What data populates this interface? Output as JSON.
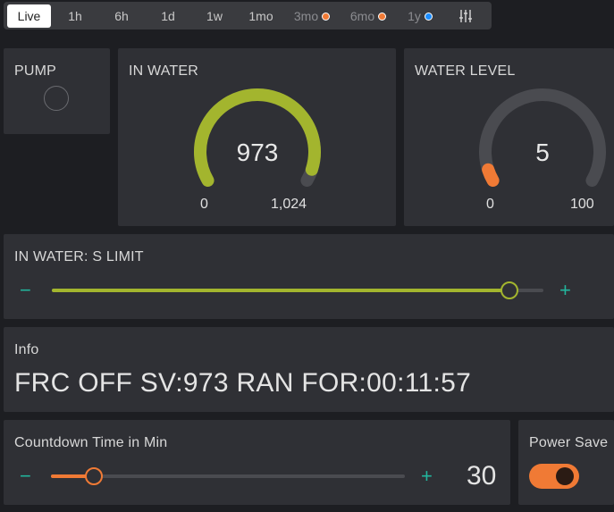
{
  "time_tabs": [
    {
      "label": "Live",
      "active": true
    },
    {
      "label": "1h"
    },
    {
      "label": "6h"
    },
    {
      "label": "1d"
    },
    {
      "label": "1w"
    },
    {
      "label": "1mo"
    },
    {
      "label": "3mo",
      "dot_color": "#f07a35",
      "dim": true
    },
    {
      "label": "6mo",
      "dot_color": "#f07a35",
      "dim": true
    },
    {
      "label": "1y",
      "dot_color": "#1a8cff",
      "dim": true
    }
  ],
  "settings_icon": "sliders-icon",
  "pump": {
    "title": "PUMP",
    "led_state": "off"
  },
  "in_water": {
    "title": "IN WATER",
    "value": "973",
    "min": "0",
    "max": "1,024",
    "color": "#a3b52e",
    "fraction": 0.95
  },
  "water_level": {
    "title": "WATER LEVEL",
    "value": "5",
    "min": "0",
    "max": "100",
    "color": "#f07a35",
    "fraction": 0.05
  },
  "limit_slider": {
    "title": "IN WATER: S LIMIT",
    "minus": "−",
    "plus": "+",
    "fraction": 0.93,
    "color": "#a3b52e"
  },
  "info": {
    "title": "Info",
    "text": "FRC OFF SV:973 RAN FOR:00:11:57"
  },
  "countdown": {
    "title": "Countdown Time in Min",
    "minus": "−",
    "plus": "+",
    "value": "30",
    "fraction": 0.12,
    "color": "#f07a35"
  },
  "power_save": {
    "title": "Power Save",
    "on": true,
    "color": "#f07a35"
  }
}
